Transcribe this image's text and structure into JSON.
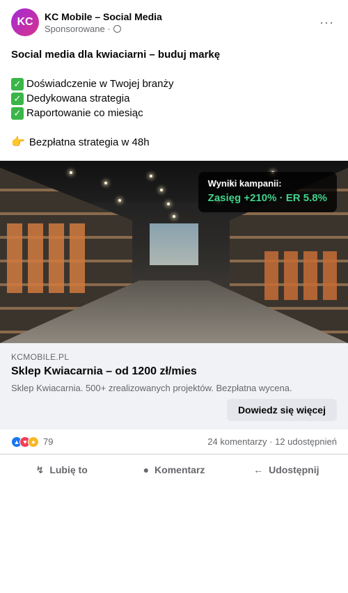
{
  "header": {
    "avatar_initials": "KC",
    "page_name": "KC Mobile – Social Media",
    "sponsored": "Sponsorowane ·",
    "more": "···"
  },
  "body": {
    "headline": "Social media dla kwiaciarni – buduj markę",
    "bullets": [
      "Doświadczenie w Twojej branży",
      "Dedykowana strategia",
      "Raportowanie co miesiąc"
    ],
    "check_glyph": "✓",
    "cta_icon": "👉",
    "cta_text": "Bezpłatna strategia w 48h"
  },
  "image": {
    "overlay_title": "Wyniki kampanii:",
    "overlay_stat": "Zasięg +210% · ER 5.8%"
  },
  "link": {
    "domain": "KCMOBILE.PL",
    "title": "Sklep Kwiacarnia – od 1200 zł/mies",
    "description": "Sklep Kwiacarnia. 500+ zrealizowanych projektów. Bezpłatna wycena.",
    "button": "Dowiedz się więcej"
  },
  "reactions": {
    "count": "79",
    "stats": "24 komentarzy · 12 udostępnień"
  },
  "actions": {
    "like": "Lubię to",
    "comment": "Komentarz",
    "share": "Udostępnij"
  },
  "colors": {
    "accent_green": "#41d38b",
    "like_blue": "#1877f2"
  }
}
